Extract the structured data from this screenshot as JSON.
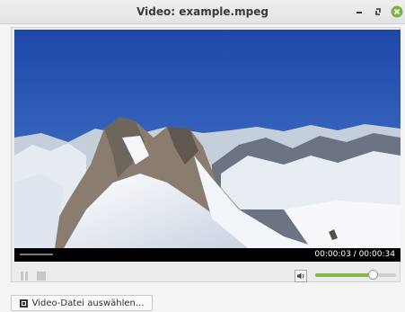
{
  "window": {
    "title": "Video: example.mpeg",
    "buttons": {
      "minimize_icon": "minimize-icon",
      "restore_icon": "restore-icon",
      "close_icon": "close-icon",
      "close_color": "#7cb342"
    }
  },
  "player": {
    "time_display": "00:00:03 / 00:00:34",
    "progress_fraction": 0.088,
    "volume_fraction": 0.72,
    "accent_color": "#8ab547",
    "controls": {
      "pause_icon": "pause-icon",
      "stop_icon": "stop-icon",
      "volume_icon": "speaker-icon"
    }
  },
  "footer": {
    "select_video_label": "Video-Datei auswählen...",
    "select_video_icon": "file-icon"
  }
}
